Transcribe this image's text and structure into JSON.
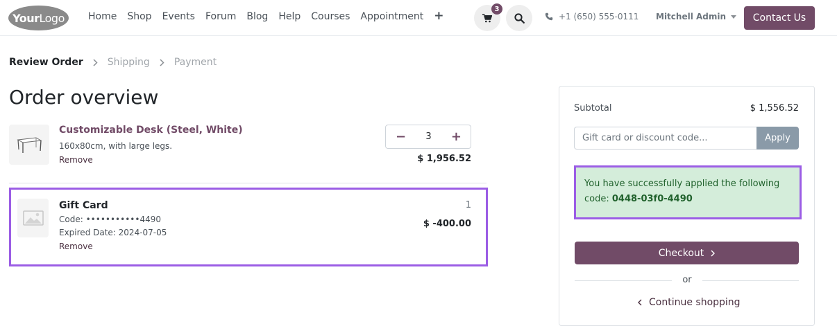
{
  "header": {
    "logo_bold": "Your",
    "logo_light": "Logo",
    "nav": [
      "Home",
      "Shop",
      "Events",
      "Forum",
      "Blog",
      "Help",
      "Courses",
      "Appointment"
    ],
    "add_icon": "+",
    "cart_count": "3",
    "phone": "+1 (650) 555-0111",
    "user": "Mitchell Admin",
    "contact_label": "Contact Us"
  },
  "steps": {
    "review": "Review Order",
    "shipping": "Shipping",
    "payment": "Payment"
  },
  "main": {
    "title": "Order overview",
    "lines": [
      {
        "name": "Customizable Desk (Steel, White)",
        "description": "160x80cm, with large legs.",
        "remove": "Remove",
        "quantity": "3",
        "price": "$ 1,956.52"
      },
      {
        "name": "Gift Card",
        "code": "Code: •••••••••••4490",
        "expiry": "Expired Date: 2024-07-05",
        "remove": "Remove",
        "quantity": "1",
        "price": "$ -400.00"
      }
    ]
  },
  "summary": {
    "subtotal_label": "Subtotal",
    "subtotal_value": "$ 1,556.52",
    "code_placeholder": "Gift card or discount code...",
    "apply_label": "Apply",
    "success_text": "You have successfully applied the following code:",
    "success_code": "0448-03f0-4490",
    "checkout_label": "Checkout",
    "or_label": "or",
    "continue_label": "Continue shopping"
  },
  "colors": {
    "brand": "#714b67",
    "highlight": "#9b5de5",
    "success_bg": "#d4edda"
  }
}
